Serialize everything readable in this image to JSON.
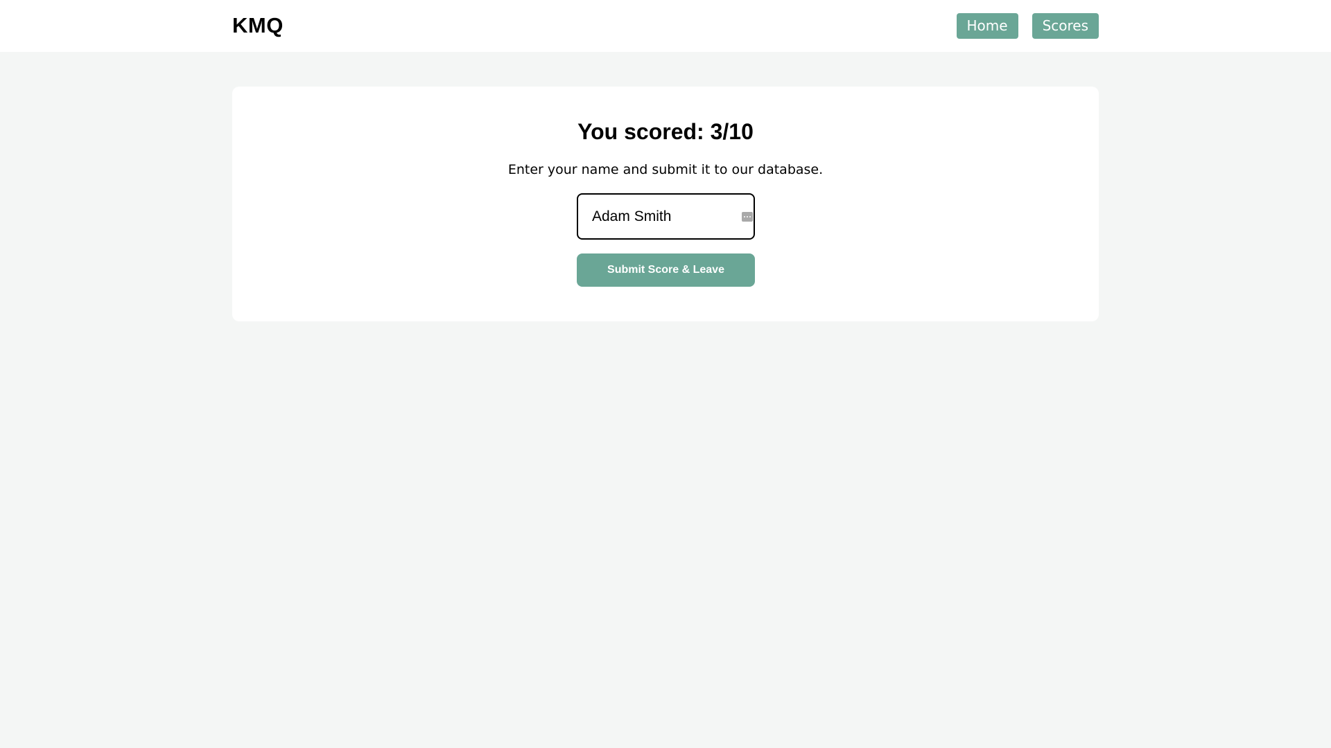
{
  "header": {
    "brand": "KMQ",
    "nav": [
      {
        "label": "Home"
      },
      {
        "label": "Scores"
      }
    ]
  },
  "result": {
    "title": "You scored: 3/10",
    "instructions": "Enter your name and submit it to our database.",
    "name_value": "Adam Smith",
    "submit_label": "Submit Score & Leave"
  },
  "icons": {
    "field_icon": "more-dots-icon"
  },
  "colors": {
    "accent": "#6aa696",
    "page_background": "#f4f6f5",
    "card_background": "#ffffff"
  }
}
